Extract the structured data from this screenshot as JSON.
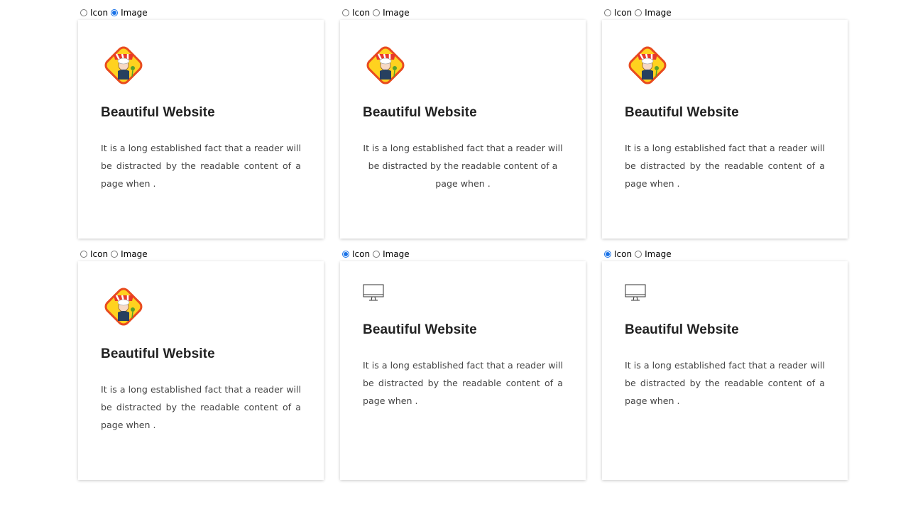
{
  "radio_labels": {
    "icon": "Icon",
    "image": "Image"
  },
  "cards": [
    {
      "mode": "image",
      "title": "Beautiful Website",
      "text": "It is a long established fact that a reader will be distracted by the readable content of a page when .",
      "align": "justify"
    },
    {
      "mode": "none",
      "title": "Beautiful Website",
      "text": "It is a long established fact that a reader will be distracted by the readable content of a page when .",
      "align": "center"
    },
    {
      "mode": "none",
      "title": "Beautiful Website",
      "text": "It is a long established fact that a reader will be distracted by the readable content of a page when .",
      "align": "justify"
    },
    {
      "mode": "none",
      "title": "Beautiful Website",
      "text": "It is a long established fact that a reader will be distracted by the readable content of a page when .",
      "align": "justify"
    },
    {
      "mode": "icon",
      "title": "Beautiful Website",
      "text": "It is a long established fact that a reader will be distracted by the readable content of a page when .",
      "align": "justify"
    },
    {
      "mode": "icon",
      "title": "Beautiful Website",
      "text": "It is a long established fact that a reader will be distracted by the readable content of a page when .",
      "align": "justify"
    }
  ],
  "colors": {
    "radio_checked": "#1a73e8",
    "title": "#222222",
    "body": "#444444"
  },
  "icons": {
    "image": "chef-mascot-logo",
    "icon": "monitor-icon"
  }
}
